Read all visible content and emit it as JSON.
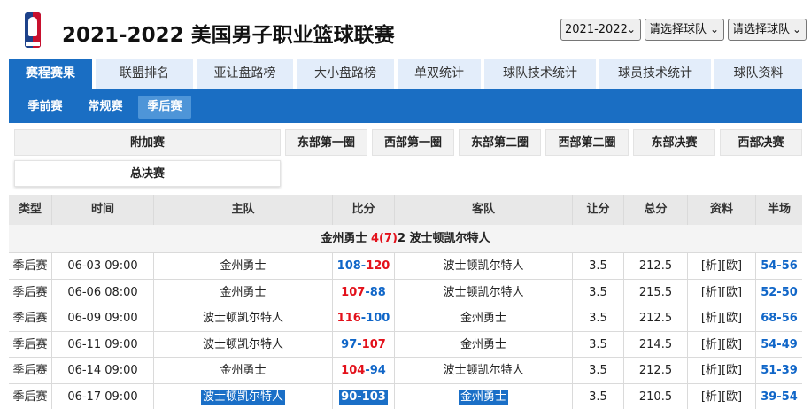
{
  "header": {
    "title": "2021-2022 美国男子职业篮球联赛",
    "season_select": "2021-2022",
    "team_select_1": "请选择球队",
    "team_select_2": "请选择球队"
  },
  "tabs": [
    {
      "label": "赛程赛果",
      "active": true
    },
    {
      "label": "联盟排名"
    },
    {
      "label": "亚让盘路榜"
    },
    {
      "label": "大小盘路榜"
    },
    {
      "label": "单双统计"
    },
    {
      "label": "球队技术统计"
    },
    {
      "label": "球员技术统计"
    },
    {
      "label": "球队资料"
    }
  ],
  "subtabs": [
    {
      "label": "季前赛"
    },
    {
      "label": "常规赛"
    },
    {
      "label": "季后赛",
      "active": true
    }
  ],
  "phases": [
    "附加赛",
    "东部第一圈",
    "西部第一圈",
    "东部第二圈",
    "西部第二圈",
    "东部决赛",
    "西部决赛",
    "总决赛"
  ],
  "table": {
    "headers": [
      "类型",
      "时间",
      "主队",
      "比分",
      "客队",
      "让分",
      "总分",
      "资料",
      "半场"
    ],
    "series": {
      "team_a": "金州勇士",
      "wins_a": "4",
      "games": "(7)",
      "wins_b": "2",
      "team_b": "波士顿凯尔特人"
    },
    "rows": [
      {
        "type": "季后赛",
        "time": "06-03 09:00",
        "home": "金州勇士",
        "home_score": "108",
        "away_score": "120",
        "away": "波士顿凯尔特人",
        "spread": "3.5",
        "total": "212.5",
        "info": "[析][欧]",
        "half": "54-56"
      },
      {
        "type": "季后赛",
        "time": "06-06 08:00",
        "home": "金州勇士",
        "home_score": "107",
        "away_score": "88",
        "away": "波士顿凯尔特人",
        "spread": "3.5",
        "total": "215.5",
        "info": "[析][欧]",
        "half": "52-50"
      },
      {
        "type": "季后赛",
        "time": "06-09 09:00",
        "home": "波士顿凯尔特人",
        "home_score": "116",
        "away_score": "100",
        "away": "金州勇士",
        "spread": "3.5",
        "total": "212.5",
        "info": "[析][欧]",
        "half": "68-56"
      },
      {
        "type": "季后赛",
        "time": "06-11 09:00",
        "home": "波士顿凯尔特人",
        "home_score": "97",
        "away_score": "107",
        "away": "金州勇士",
        "spread": "3.5",
        "total": "214.5",
        "info": "[析][欧]",
        "half": "54-49"
      },
      {
        "type": "季后赛",
        "time": "06-14 09:00",
        "home": "金州勇士",
        "home_score": "104",
        "away_score": "94",
        "away": "波士顿凯尔特人",
        "spread": "3.5",
        "total": "212.5",
        "info": "[析][欧]",
        "half": "51-39"
      },
      {
        "type": "季后赛",
        "time": "06-17 09:00",
        "home": "波士顿凯尔特人",
        "home_score": "90",
        "away_score": "103",
        "away": "金州勇士",
        "spread": "3.5",
        "total": "210.5",
        "info": "[析][欧]",
        "half": "39-54"
      }
    ]
  },
  "colors": {
    "accent": "#1a6ec3",
    "win": "#e3111b",
    "loss": "#1066c8",
    "tab_bg": "#e3edfa",
    "selection": "#1a6fc7"
  }
}
